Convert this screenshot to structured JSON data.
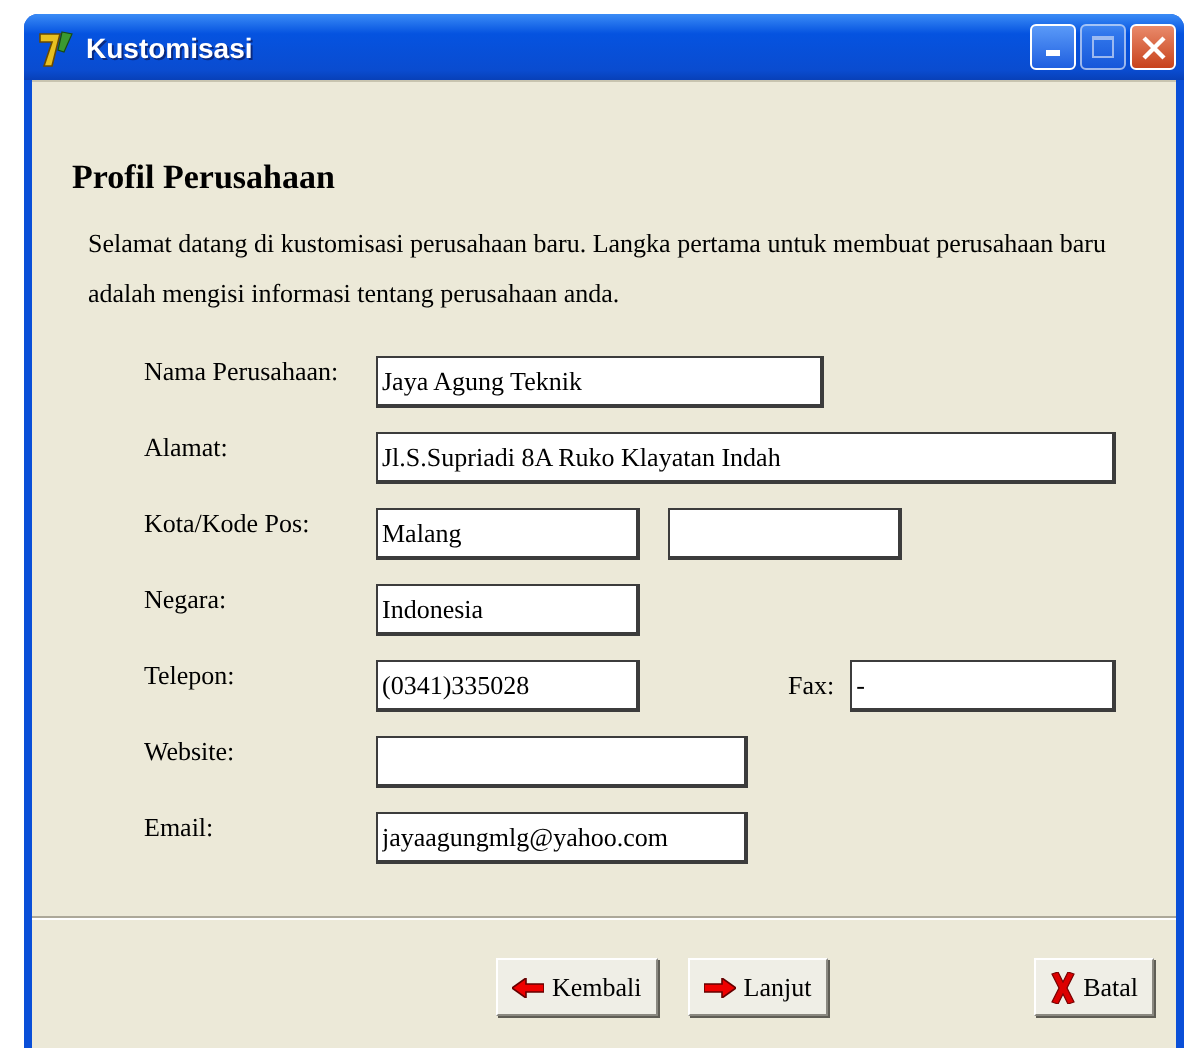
{
  "window": {
    "title": "Kustomisasi"
  },
  "heading": "Profil Perusahaan",
  "description": "Selamat datang di kustomisasi perusahaan baru. Langka pertama untuk membuat perusahaan baru adalah mengisi informasi tentang perusahaan anda.",
  "rows": [
    {
      "items": [
        {
          "kind": "label",
          "text": "Nama Perusahaan:"
        },
        {
          "kind": "input",
          "value": "Jaya Agung Teknik"
        }
      ]
    },
    {
      "items": [
        {
          "kind": "label",
          "text": "Alamat:"
        },
        {
          "kind": "input",
          "value": "Jl.S.Supriadi 8A Ruko Klayatan Indah"
        }
      ]
    },
    {
      "items": [
        {
          "kind": "label",
          "text": "Kota/Kode Pos:"
        },
        {
          "kind": "input",
          "value": "Malang"
        },
        {
          "kind": "input"
        }
      ]
    },
    {
      "items": [
        {
          "kind": "label",
          "text": "Negara:"
        },
        {
          "kind": "input",
          "value": "Indonesia"
        }
      ]
    },
    {
      "items": [
        {
          "kind": "label",
          "text": "Telepon:"
        },
        {
          "kind": "input",
          "value": "(0341)335028"
        },
        {
          "kind": "label",
          "text": "Fax:"
        },
        {
          "kind": "input",
          "value": "-"
        }
      ]
    },
    {
      "items": [
        {
          "kind": "label",
          "text": "Website:"
        },
        {
          "kind": "input"
        }
      ]
    },
    {
      "items": [
        {
          "kind": "label",
          "text": "Email:"
        },
        {
          "kind": "input",
          "value": "jayaagungmlg@yahoo.com"
        }
      ]
    }
  ],
  "buttons": [
    {
      "label": "Kembali",
      "kind": "back"
    },
    {
      "label": "Lanjut",
      "kind": "next"
    },
    {
      "label": "Batal",
      "kind": "cancel"
    }
  ]
}
